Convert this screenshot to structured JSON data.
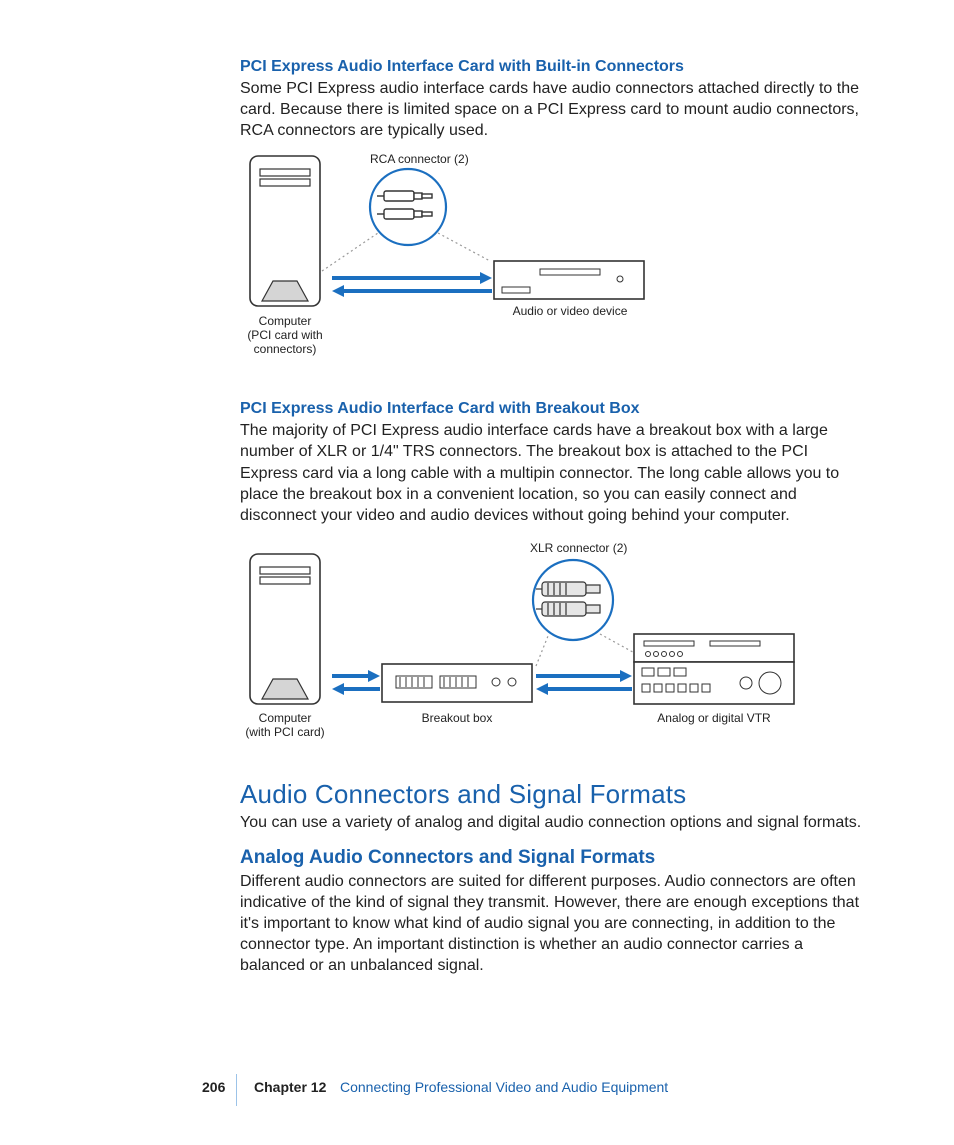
{
  "section1": {
    "heading": "PCI Express Audio Interface Card with Built-in Connectors",
    "body": "Some PCI Express audio interface cards have audio connectors attached directly to the card. Because there is limited space on a PCI Express card to mount audio connectors, RCA connectors are typically used."
  },
  "diagram1": {
    "label_connector": "RCA connector (2)",
    "label_computer_l1": "Computer",
    "label_computer_l2": "(PCI card with",
    "label_computer_l3": "connectors)",
    "label_device": "Audio or video device"
  },
  "section2": {
    "heading": "PCI Express Audio Interface Card with Breakout Box",
    "body": "The majority of PCI Express audio interface cards have a breakout box with a large number of XLR or 1/4\" TRS connectors. The breakout box is attached to the PCI Express card via a long cable with a multipin connector. The long cable allows you to place the breakout box in a convenient location, so you can easily connect and disconnect your video and audio devices without going behind your computer."
  },
  "diagram2": {
    "label_connector": "XLR connector (2)",
    "label_computer_l1": "Computer",
    "label_computer_l2": "(with PCI card)",
    "label_breakout": "Breakout box",
    "label_device": "Analog or digital VTR"
  },
  "section3": {
    "title": "Audio Connectors and Signal Formats",
    "body": "You can use a variety of analog and digital audio connection options and signal formats."
  },
  "section4": {
    "title": "Analog Audio Connectors and Signal Formats",
    "body": "Different audio connectors are suited for different purposes. Audio connectors are often indicative of the kind of signal they transmit. However, there are enough exceptions that it's important to know what kind of audio signal you are connecting, in addition to the connector type. An important distinction is whether an audio connector carries a balanced or an unbalanced signal."
  },
  "footer": {
    "page": "206",
    "chapter": "Chapter 12",
    "title": "Connecting Professional Video and Audio Equipment"
  }
}
